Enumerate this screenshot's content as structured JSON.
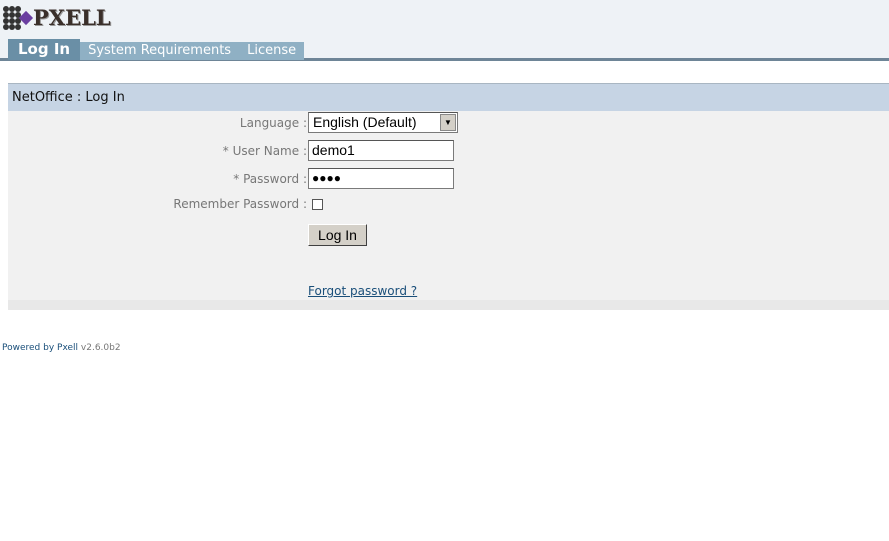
{
  "logo": {
    "text": "PXELL"
  },
  "tabs": [
    {
      "label": "Log In",
      "active": true
    },
    {
      "label": "System Requirements"
    },
    {
      "label": "License"
    }
  ],
  "panel": {
    "title": "NetOffice : Log In"
  },
  "form": {
    "language_label": "Language :",
    "language_value": "English (Default)",
    "username_label": "* User Name :",
    "username_value": "demo1",
    "password_label": "* Password :",
    "password_value": "●●●●",
    "remember_label": "Remember Password :",
    "remember_checked": false,
    "login_button": "Log In",
    "forgot_link": "Forgot password ?"
  },
  "footer": {
    "powered": "Powered by Pxell",
    "version": "v2.6.0b2"
  }
}
